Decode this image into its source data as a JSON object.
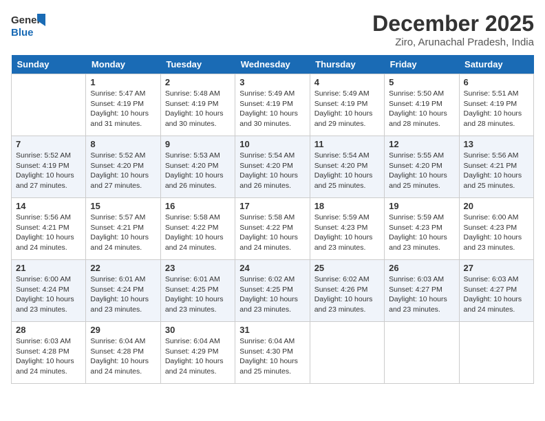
{
  "logo": {
    "line1": "General",
    "line2": "Blue"
  },
  "title": "December 2025",
  "subtitle": "Ziro, Arunachal Pradesh, India",
  "days_of_week": [
    "Sunday",
    "Monday",
    "Tuesday",
    "Wednesday",
    "Thursday",
    "Friday",
    "Saturday"
  ],
  "weeks": [
    [
      {
        "day": "",
        "info": ""
      },
      {
        "day": "1",
        "info": "Sunrise: 5:47 AM\nSunset: 4:19 PM\nDaylight: 10 hours\nand 31 minutes."
      },
      {
        "day": "2",
        "info": "Sunrise: 5:48 AM\nSunset: 4:19 PM\nDaylight: 10 hours\nand 30 minutes."
      },
      {
        "day": "3",
        "info": "Sunrise: 5:49 AM\nSunset: 4:19 PM\nDaylight: 10 hours\nand 30 minutes."
      },
      {
        "day": "4",
        "info": "Sunrise: 5:49 AM\nSunset: 4:19 PM\nDaylight: 10 hours\nand 29 minutes."
      },
      {
        "day": "5",
        "info": "Sunrise: 5:50 AM\nSunset: 4:19 PM\nDaylight: 10 hours\nand 28 minutes."
      },
      {
        "day": "6",
        "info": "Sunrise: 5:51 AM\nSunset: 4:19 PM\nDaylight: 10 hours\nand 28 minutes."
      }
    ],
    [
      {
        "day": "7",
        "info": "Sunrise: 5:52 AM\nSunset: 4:19 PM\nDaylight: 10 hours\nand 27 minutes."
      },
      {
        "day": "8",
        "info": "Sunrise: 5:52 AM\nSunset: 4:20 PM\nDaylight: 10 hours\nand 27 minutes."
      },
      {
        "day": "9",
        "info": "Sunrise: 5:53 AM\nSunset: 4:20 PM\nDaylight: 10 hours\nand 26 minutes."
      },
      {
        "day": "10",
        "info": "Sunrise: 5:54 AM\nSunset: 4:20 PM\nDaylight: 10 hours\nand 26 minutes."
      },
      {
        "day": "11",
        "info": "Sunrise: 5:54 AM\nSunset: 4:20 PM\nDaylight: 10 hours\nand 25 minutes."
      },
      {
        "day": "12",
        "info": "Sunrise: 5:55 AM\nSunset: 4:20 PM\nDaylight: 10 hours\nand 25 minutes."
      },
      {
        "day": "13",
        "info": "Sunrise: 5:56 AM\nSunset: 4:21 PM\nDaylight: 10 hours\nand 25 minutes."
      }
    ],
    [
      {
        "day": "14",
        "info": "Sunrise: 5:56 AM\nSunset: 4:21 PM\nDaylight: 10 hours\nand 24 minutes."
      },
      {
        "day": "15",
        "info": "Sunrise: 5:57 AM\nSunset: 4:21 PM\nDaylight: 10 hours\nand 24 minutes."
      },
      {
        "day": "16",
        "info": "Sunrise: 5:58 AM\nSunset: 4:22 PM\nDaylight: 10 hours\nand 24 minutes."
      },
      {
        "day": "17",
        "info": "Sunrise: 5:58 AM\nSunset: 4:22 PM\nDaylight: 10 hours\nand 24 minutes."
      },
      {
        "day": "18",
        "info": "Sunrise: 5:59 AM\nSunset: 4:23 PM\nDaylight: 10 hours\nand 23 minutes."
      },
      {
        "day": "19",
        "info": "Sunrise: 5:59 AM\nSunset: 4:23 PM\nDaylight: 10 hours\nand 23 minutes."
      },
      {
        "day": "20",
        "info": "Sunrise: 6:00 AM\nSunset: 4:23 PM\nDaylight: 10 hours\nand 23 minutes."
      }
    ],
    [
      {
        "day": "21",
        "info": "Sunrise: 6:00 AM\nSunset: 4:24 PM\nDaylight: 10 hours\nand 23 minutes."
      },
      {
        "day": "22",
        "info": "Sunrise: 6:01 AM\nSunset: 4:24 PM\nDaylight: 10 hours\nand 23 minutes."
      },
      {
        "day": "23",
        "info": "Sunrise: 6:01 AM\nSunset: 4:25 PM\nDaylight: 10 hours\nand 23 minutes."
      },
      {
        "day": "24",
        "info": "Sunrise: 6:02 AM\nSunset: 4:25 PM\nDaylight: 10 hours\nand 23 minutes."
      },
      {
        "day": "25",
        "info": "Sunrise: 6:02 AM\nSunset: 4:26 PM\nDaylight: 10 hours\nand 23 minutes."
      },
      {
        "day": "26",
        "info": "Sunrise: 6:03 AM\nSunset: 4:27 PM\nDaylight: 10 hours\nand 23 minutes."
      },
      {
        "day": "27",
        "info": "Sunrise: 6:03 AM\nSunset: 4:27 PM\nDaylight: 10 hours\nand 24 minutes."
      }
    ],
    [
      {
        "day": "28",
        "info": "Sunrise: 6:03 AM\nSunset: 4:28 PM\nDaylight: 10 hours\nand 24 minutes."
      },
      {
        "day": "29",
        "info": "Sunrise: 6:04 AM\nSunset: 4:28 PM\nDaylight: 10 hours\nand 24 minutes."
      },
      {
        "day": "30",
        "info": "Sunrise: 6:04 AM\nSunset: 4:29 PM\nDaylight: 10 hours\nand 24 minutes."
      },
      {
        "day": "31",
        "info": "Sunrise: 6:04 AM\nSunset: 4:30 PM\nDaylight: 10 hours\nand 25 minutes."
      },
      {
        "day": "",
        "info": ""
      },
      {
        "day": "",
        "info": ""
      },
      {
        "day": "",
        "info": ""
      }
    ]
  ]
}
